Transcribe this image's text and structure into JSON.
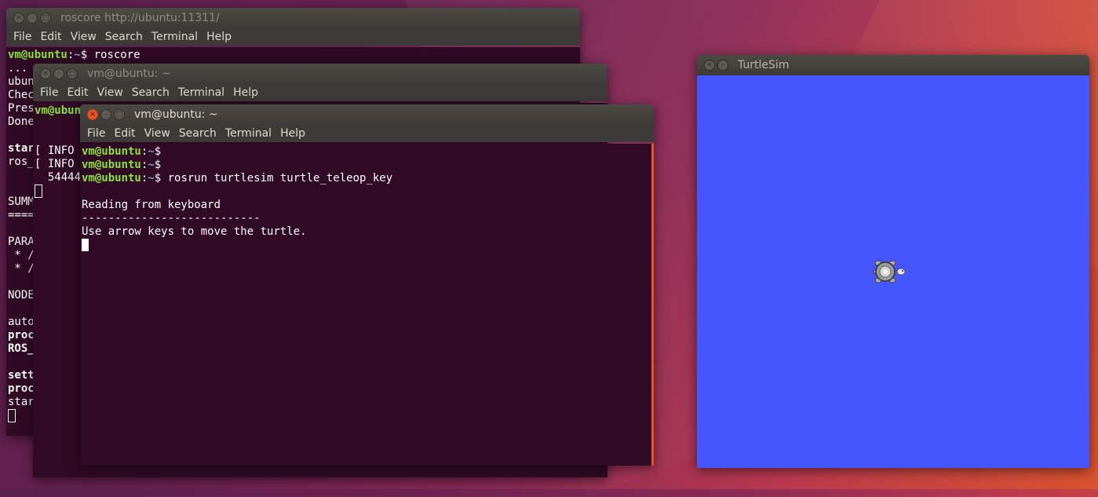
{
  "windows": {
    "roscore": {
      "title": "roscore http://ubuntu:11311/",
      "menu": [
        "File",
        "Edit",
        "View",
        "Search",
        "Terminal",
        "Help"
      ],
      "lines": [
        {
          "user": "vm@ubuntu",
          "path": "~",
          "cmd": "$ roscore"
        },
        {
          "text": "..."
        },
        {
          "text": "ubun"
        },
        {
          "text": "Chec"
        },
        {
          "text": "Pres"
        },
        {
          "text": "Done"
        },
        {
          "text": ""
        },
        {
          "text": "star",
          "bold": true
        },
        {
          "text": "ros_"
        },
        {
          "text": ""
        },
        {
          "text": ""
        },
        {
          "text": "SUMM"
        },
        {
          "text": "===="
        },
        {
          "text": ""
        },
        {
          "text": "PARA"
        },
        {
          "text": " * /"
        },
        {
          "text": " * /"
        },
        {
          "text": ""
        },
        {
          "text": "NODE"
        },
        {
          "text": ""
        },
        {
          "text": "auto"
        },
        {
          "text": "proc",
          "bold": true
        },
        {
          "text": "ROS_",
          "bold": true
        },
        {
          "text": ""
        },
        {
          "text": "sett",
          "bold": true
        },
        {
          "text": "proc",
          "bold": true
        },
        {
          "text": "star"
        }
      ]
    },
    "turtlesim_node": {
      "title": "vm@ubuntu: ~",
      "menu": [
        "File",
        "Edit",
        "View",
        "Search",
        "Terminal",
        "Help"
      ],
      "lines": [
        {
          "user": "vm@ubuntu",
          "path": "",
          "cmd": ""
        },
        {
          "text": ""
        },
        {
          "text": ""
        },
        {
          "text": "[ INFO"
        },
        {
          "text": "[ INFO"
        },
        {
          "text": "  544445"
        }
      ]
    },
    "teleop": {
      "title": "vm@ubuntu: ~",
      "menu": [
        "File",
        "Edit",
        "View",
        "Search",
        "Terminal",
        "Help"
      ],
      "lines": [
        {
          "user": "vm@ubuntu",
          "path": "~",
          "cmd": "$"
        },
        {
          "user": "vm@ubuntu",
          "path": "~",
          "cmd": "$"
        },
        {
          "user": "vm@ubuntu",
          "path": "~",
          "cmd": "$ rosrun turtlesim turtle_teleop_key"
        },
        {
          "text": ""
        },
        {
          "text": "Reading from keyboard"
        },
        {
          "text": "---------------------------"
        },
        {
          "text": "Use arrow keys to move the turtle."
        }
      ]
    },
    "turtlesim": {
      "title": "TurtleSim",
      "background_color": "#4556ff",
      "turtle_position": [
        0.49,
        0.5
      ],
      "turtle_heading": "east"
    }
  },
  "colors": {
    "terminal_bg": "#300a24",
    "prompt_user": "#8ae234",
    "prompt_path": "#729fcf",
    "accent": "#e95420"
  }
}
